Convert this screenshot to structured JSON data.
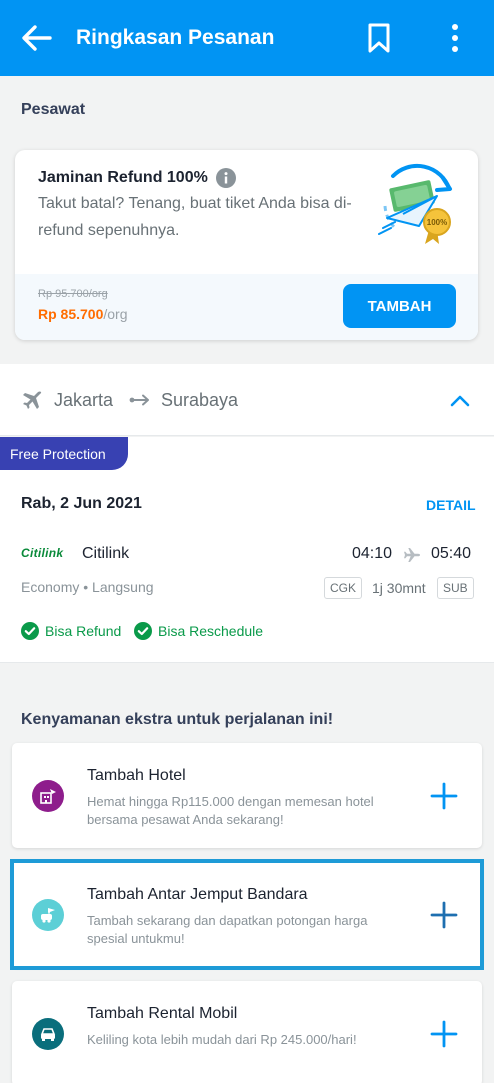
{
  "appbar": {
    "title": "Ringkasan Pesanan"
  },
  "section_flight": "Pesawat",
  "refund": {
    "title": "Jaminan Refund 100%",
    "description": "Takut batal? Tenang, buat tiket Anda bisa di-refund sepenuhnya.",
    "old_price": "Rp 95.700/org",
    "price": "Rp 85.700",
    "per": "/org",
    "button": "TAMBAH",
    "badge_text": "100%"
  },
  "route": {
    "from": "Jakarta",
    "to": "Surabaya"
  },
  "flight": {
    "tag": "Free Protection",
    "date": "Rab, 2 Jun 2021",
    "detail_label": "DETAIL",
    "airline_logo": "Citilink",
    "airline_name": "Citilink",
    "departure": "04:10",
    "arrival": "05:40",
    "cabin": "Economy • Langsung",
    "origin_code": "CGK",
    "duration": "1j 30mnt",
    "dest_code": "SUB",
    "perks": [
      "Bisa Refund",
      "Bisa Reschedule"
    ]
  },
  "section_extras": "Kenyamanan ekstra untuk perjalanan ini!",
  "extras": [
    {
      "title": "Tambah Hotel",
      "description": "Hemat hingga Rp115.000 dengan memesan hotel bersama pesawat Anda sekarang!",
      "icon": "hotel-icon",
      "color": "#8e1d8c"
    },
    {
      "title": "Tambah Antar Jemput Bandara",
      "description": "Tambah sekarang dan dapatkan potongan harga spesial untukmu!",
      "icon": "airport-transfer-icon",
      "color": "#5ccfd6"
    },
    {
      "title": "Tambah Rental Mobil",
      "description": "Keliling kota lebih mudah dari Rp 245.000/hari!",
      "icon": "car-icon",
      "color": "#0a6e7c"
    }
  ],
  "colors": {
    "primary": "#0194f3",
    "price": "#ff6d00",
    "success": "#0a9a4a",
    "tag": "#3841b2",
    "highlight": "#1e9bd7"
  }
}
